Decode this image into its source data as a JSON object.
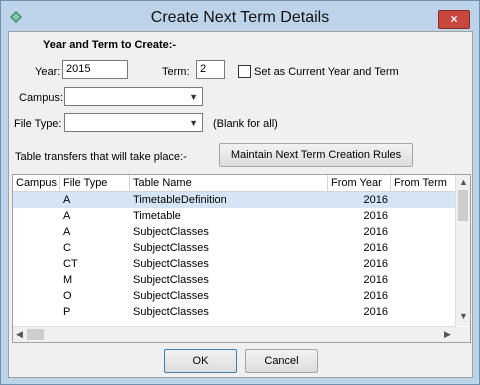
{
  "window": {
    "title": "Create Next Term Details",
    "close_label": "×",
    "colors": {
      "titlebar": "#bcd3ea",
      "close": "#c7463d",
      "selection": "#d6e5f5"
    }
  },
  "form": {
    "section_heading": "Year and Term to Create:-",
    "year_label": "Year:",
    "year_value": "2015",
    "term_label": "Term:",
    "term_value": "2",
    "current_checkbox_label": "Set as Current Year and Term",
    "current_checkbox_checked": false,
    "campus_label": "Campus:",
    "campus_value": "",
    "filetype_label": "File Type:",
    "filetype_value": "",
    "filetype_hint": "(Blank for all)",
    "transfers_label": "Table transfers that will take place:-",
    "rules_button": "Maintain Next Term Creation Rules"
  },
  "table": {
    "columns": [
      "Campus",
      "File Type",
      "Table Name",
      "From Year",
      "From Term"
    ],
    "rows": [
      {
        "campus": "",
        "file_type": "A",
        "table_name": "TimetableDefinition",
        "from_year": "2016",
        "from_term": ""
      },
      {
        "campus": "",
        "file_type": "A",
        "table_name": "Timetable",
        "from_year": "2016",
        "from_term": ""
      },
      {
        "campus": "",
        "file_type": "A",
        "table_name": "SubjectClasses",
        "from_year": "2016",
        "from_term": ""
      },
      {
        "campus": "",
        "file_type": "C",
        "table_name": "SubjectClasses",
        "from_year": "2016",
        "from_term": ""
      },
      {
        "campus": "",
        "file_type": "CT",
        "table_name": "SubjectClasses",
        "from_year": "2016",
        "from_term": ""
      },
      {
        "campus": "",
        "file_type": "M",
        "table_name": "SubjectClasses",
        "from_year": "2016",
        "from_term": ""
      },
      {
        "campus": "",
        "file_type": "O",
        "table_name": "SubjectClasses",
        "from_year": "2016",
        "from_term": ""
      },
      {
        "campus": "",
        "file_type": "P",
        "table_name": "SubjectClasses",
        "from_year": "2016",
        "from_term": ""
      }
    ]
  },
  "buttons": {
    "ok": "OK",
    "cancel": "Cancel"
  }
}
